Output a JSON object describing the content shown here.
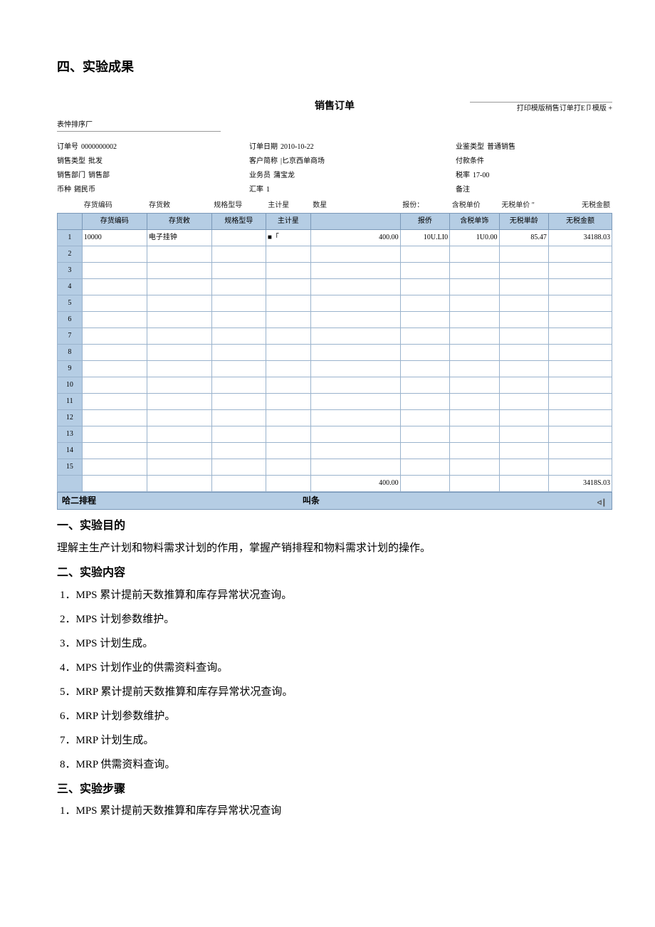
{
  "heading_result": "四、实验成果",
  "order": {
    "title": "销售订单",
    "print_info": "打印模版稍售订单打E卩模版 +",
    "sort_label": "表忡排序厂",
    "info_rows": [
      {
        "l1": "订单号",
        "v1": "0000000002",
        "l2": "订单日期",
        "v2": "2010-10-22",
        "l3": "业鉴类型",
        "v3": "普通销售"
      },
      {
        "l1": "销售类型",
        "v1": "批发",
        "l2": "客户简称",
        "v2": "|匕京西单商场",
        "l3": "付款条件",
        "v3": ""
      },
      {
        "l1": "销售部门",
        "v1": "销售部",
        "l2": "业务员",
        "v2": "蒲宝龙",
        "l3": "税率",
        "v3": "17-00"
      },
      {
        "l1": "币种",
        "v1": "鎺民币",
        "l2": "汇率",
        "v2": "1",
        "l3": "备注",
        "v3": ""
      }
    ],
    "head_top": [
      "",
      "存货编码",
      "存货敕",
      "规格型导",
      "主计星",
      "数星",
      "",
      "报份：",
      "含税单价",
      "无税单价 \"",
      "无税金额"
    ],
    "head_main": [
      "",
      "存货编码",
      "存货敕",
      "规格型导",
      "主计星",
      "",
      "报侨",
      "含税单饰",
      "无税単龄",
      "无税金额"
    ],
    "rows": [
      {
        "n": "1",
        "code": "10000",
        "name": "电子挂钟",
        "spec": "",
        "unit": "■「",
        "qty": "400.00",
        "rpt": "10U.LI0",
        "tax_price": "1U0.00",
        "notax_price": "85.47",
        "notax_amt": "34188.03"
      },
      {
        "n": "2"
      },
      {
        "n": "3"
      },
      {
        "n": "4"
      },
      {
        "n": "5"
      },
      {
        "n": "6"
      },
      {
        "n": "7"
      },
      {
        "n": "8"
      },
      {
        "n": "9"
      },
      {
        "n": "10"
      },
      {
        "n": "11"
      },
      {
        "n": "12"
      },
      {
        "n": "13"
      },
      {
        "n": "14"
      },
      {
        "n": "15"
      }
    ],
    "totals": {
      "qty": "400.00",
      "amt": "3418S.03"
    },
    "footer_left": "哈二排程",
    "footer_mid": "叫条",
    "footer_right": "ᐊ┃"
  },
  "section1": "一、实验目的",
  "text1": "理解主生产计划和物料需求计划的作用，掌握产销排程和物料需求计划的操作。",
  "section2": "二、实验内容",
  "items2": [
    "1．MPS 累计提前天数推算和库存异常状况查询。",
    "2．MPS 计划参数维护。",
    "3．MPS 计划生成。",
    "4．MPS 计划作业的供需资料查询。",
    "5．MRP 累计提前天数推算和库存异常状况查询。",
    "6．MRP 计划参数维护。",
    "7．MRP 计划生成。",
    "8．MRP 供需资料查询。"
  ],
  "section3": "三、实验步骤",
  "text3": "1．MPS 累计提前天数推算和库存异常状况查询"
}
